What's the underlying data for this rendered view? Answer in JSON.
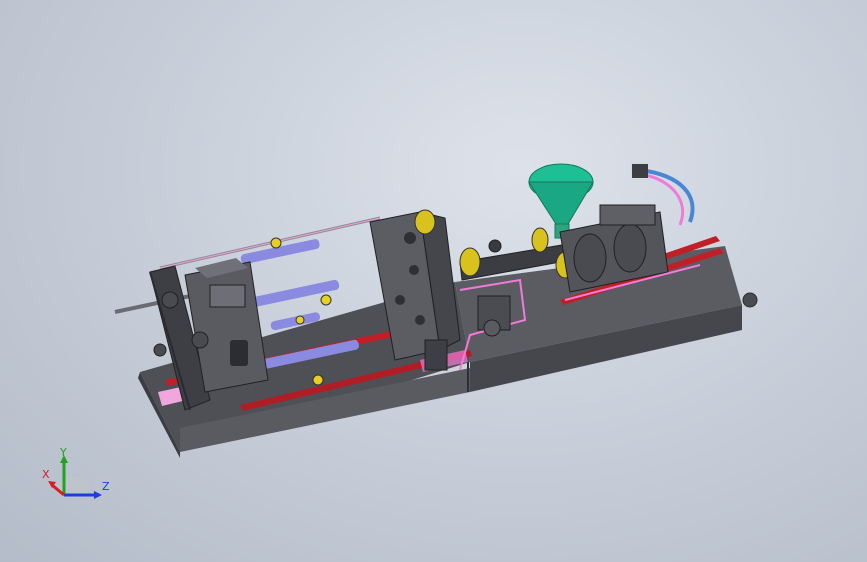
{
  "viewport": {
    "background": "#c9d0da"
  },
  "triad": {
    "x_label": "X",
    "y_label": "Y",
    "z_label": "Z",
    "colors": {
      "x": "#d42020",
      "y": "#1fa41f",
      "z": "#1c3fd8"
    }
  },
  "model": {
    "colors": {
      "steel": "#56575d",
      "steel_dark": "#3d3e44",
      "steel_light": "#7b7c84",
      "base_top": "#6d6e74",
      "base_side": "#4e4f55",
      "rail_red": "#c01f28",
      "rod_blue": "#8a8ae0",
      "pink_line": "#f07ad8",
      "hopper": "#1fbf95",
      "hose_blue": "#4a86d4",
      "yellow": "#e8d020"
    }
  }
}
